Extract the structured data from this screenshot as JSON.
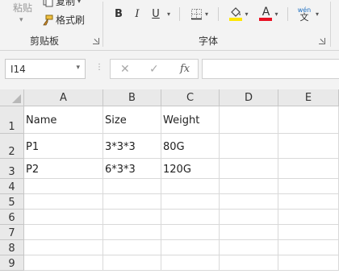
{
  "ribbon": {
    "clipboard": {
      "paste_label": "粘贴",
      "copy_label": "复制",
      "format_painter_label": "格式刷",
      "group_label": "剪贴板"
    },
    "font": {
      "bold": "B",
      "italic": "I",
      "underline": "U",
      "font_color_letter": "A",
      "phonetic_top": "wén",
      "phonetic_bottom": "文",
      "group_label": "字体",
      "fill_color": "#ffe600",
      "font_color": "#e81123"
    }
  },
  "formula_bar": {
    "name_box": "I14",
    "cancel_icon": "✕",
    "enter_icon": "✓",
    "fx_label": "fx",
    "formula": ""
  },
  "sheet": {
    "columns": [
      "A",
      "B",
      "C",
      "D",
      "E"
    ],
    "rows": [
      {
        "num": "1",
        "cells": [
          "Name",
          "Size",
          "Weight",
          "",
          ""
        ]
      },
      {
        "num": "2",
        "cells": [
          "P1",
          "3*3*3",
          "80G",
          "",
          ""
        ]
      },
      {
        "num": "3",
        "cells": [
          "P2",
          "6*3*3",
          "120G",
          "",
          ""
        ]
      },
      {
        "num": "4",
        "cells": [
          "",
          "",
          "",
          "",
          ""
        ]
      },
      {
        "num": "5",
        "cells": [
          "",
          "",
          "",
          "",
          ""
        ]
      },
      {
        "num": "6",
        "cells": [
          "",
          "",
          "",
          "",
          ""
        ]
      },
      {
        "num": "7",
        "cells": [
          "",
          "",
          "",
          "",
          ""
        ]
      },
      {
        "num": "8",
        "cells": [
          "",
          "",
          "",
          "",
          ""
        ]
      },
      {
        "num": "9",
        "cells": [
          "",
          "",
          "",
          "",
          ""
        ]
      }
    ]
  }
}
